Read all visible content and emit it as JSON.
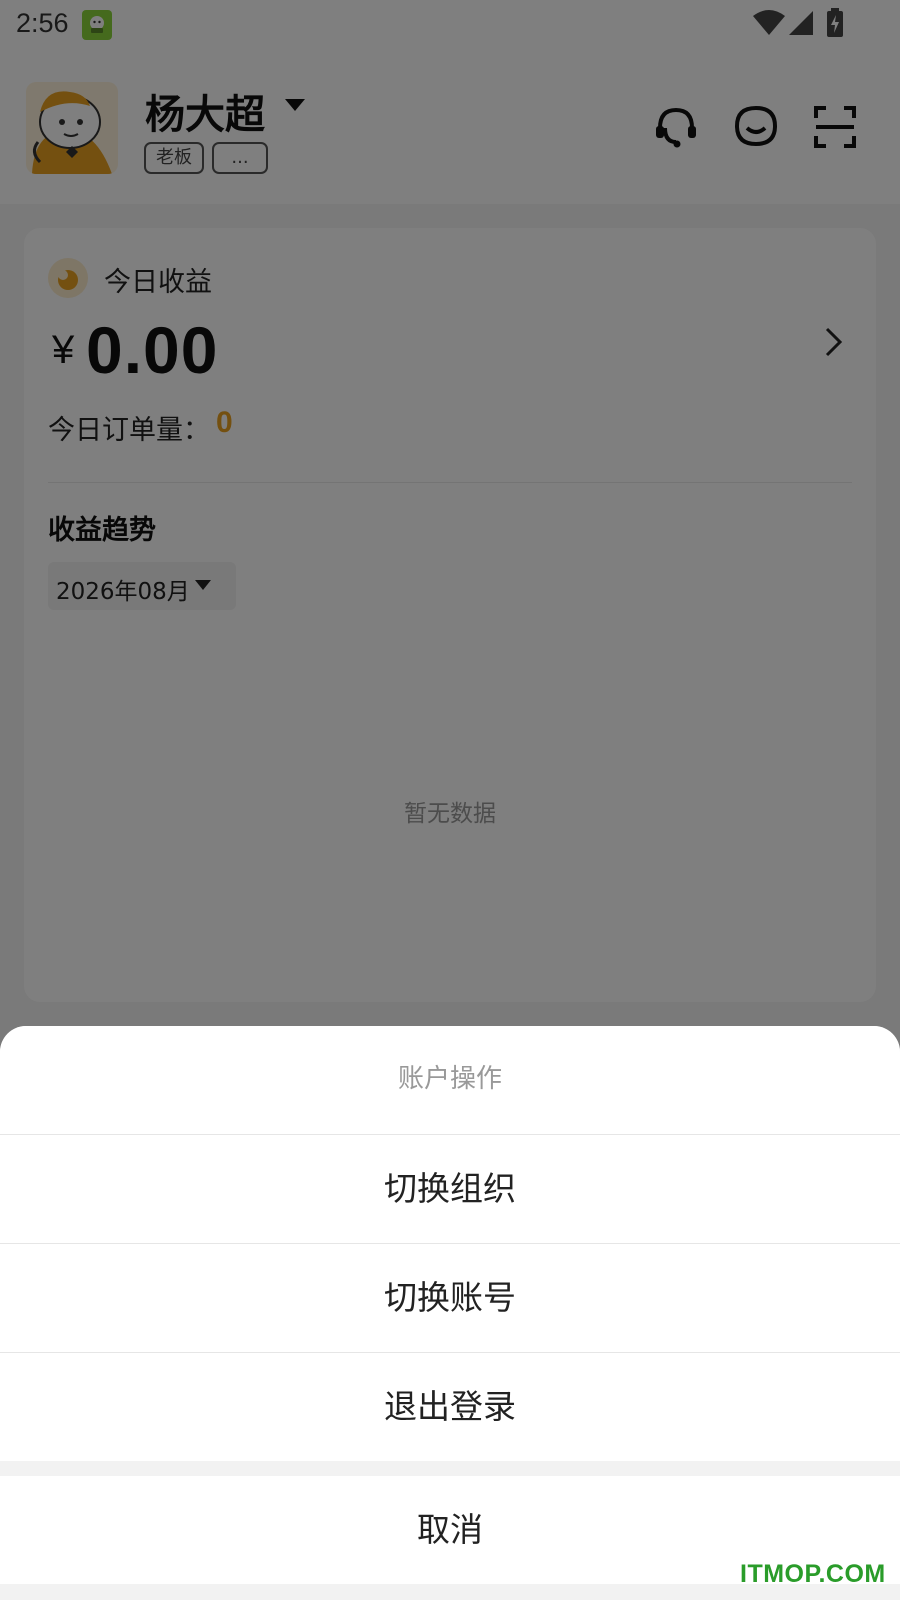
{
  "status_bar": {
    "time": "2:56",
    "icons": [
      "app-notification-icon",
      "wifi-icon",
      "cell-signal-icon",
      "battery-charging-icon"
    ]
  },
  "header": {
    "user_name": "杨大超",
    "role_tag": "老板",
    "more_tag": "...",
    "icons": [
      "customer-service-icon",
      "chat-icon",
      "scan-icon"
    ]
  },
  "card": {
    "earnings_label": "今日收益",
    "currency_symbol": "¥",
    "earnings_amount": "0.00",
    "orders_label": "今日订单量：",
    "orders_count": "0",
    "trend_title": "收益趋势",
    "month_selected": "2026年08月",
    "no_data_text": "暂无数据"
  },
  "action_sheet": {
    "title": "账户操作",
    "items": [
      {
        "label": "切换组织"
      },
      {
        "label": "切换账号"
      },
      {
        "label": "退出登录"
      }
    ],
    "cancel_label": "取消"
  },
  "watermark": "ITMOP.COM",
  "colors": {
    "accent_orange": "#e8a020",
    "overlay": "rgba(0,0,0,0.5)",
    "watermark_green": "#2a9c2a"
  }
}
